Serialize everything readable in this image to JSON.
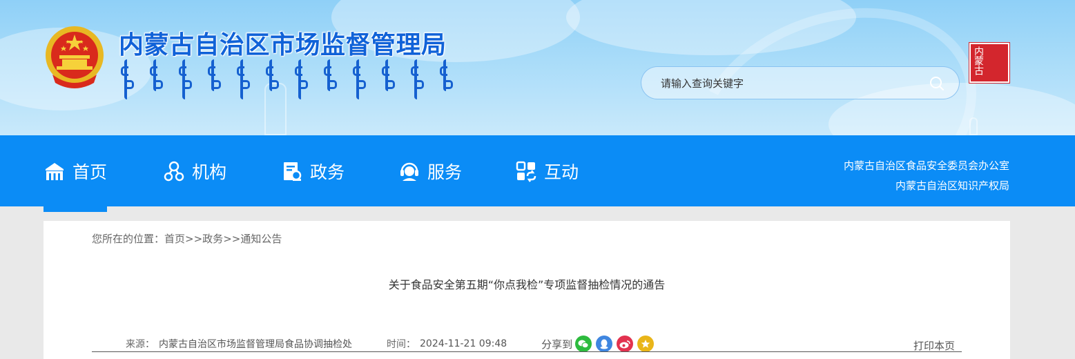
{
  "header": {
    "site_title": "内蒙古自治区市场监督管理局",
    "search": {
      "placeholder": "请输入查询关键字"
    },
    "seal_text": "内蒙古"
  },
  "nav": {
    "items": [
      {
        "label": "首页",
        "icon": "home-icon",
        "active": true
      },
      {
        "label": "机构",
        "icon": "organization-icon"
      },
      {
        "label": "政务",
        "icon": "government-affairs-icon"
      },
      {
        "label": "服务",
        "icon": "service-icon"
      },
      {
        "label": "互动",
        "icon": "interaction-icon"
      }
    ],
    "links": [
      "内蒙古自治区食品安全委员会办公室",
      "内蒙古自治区知识产权局"
    ]
  },
  "breadcrumb": {
    "prefix": "您所在的位置：",
    "items": [
      "首页",
      "政务",
      "通知公告"
    ],
    "separator": ">>"
  },
  "article": {
    "title": "关于食品安全第五期“你点我检”专项监督抽检情况的通告",
    "source_label": "来源：",
    "source": "内蒙古自治区市场监督管理局食品协调抽检处",
    "time_label": "时间：",
    "time": "2024-11-21 09:48",
    "share_label": "分享到",
    "print_label": "打印本页"
  },
  "colors": {
    "nav_bg": "#0b8cf6",
    "title_blue": "#1062d8",
    "wechat": "#2dbb3e",
    "qq": "#3f86e0",
    "weibo": "#e2324f",
    "qzone": "#e9b519"
  }
}
